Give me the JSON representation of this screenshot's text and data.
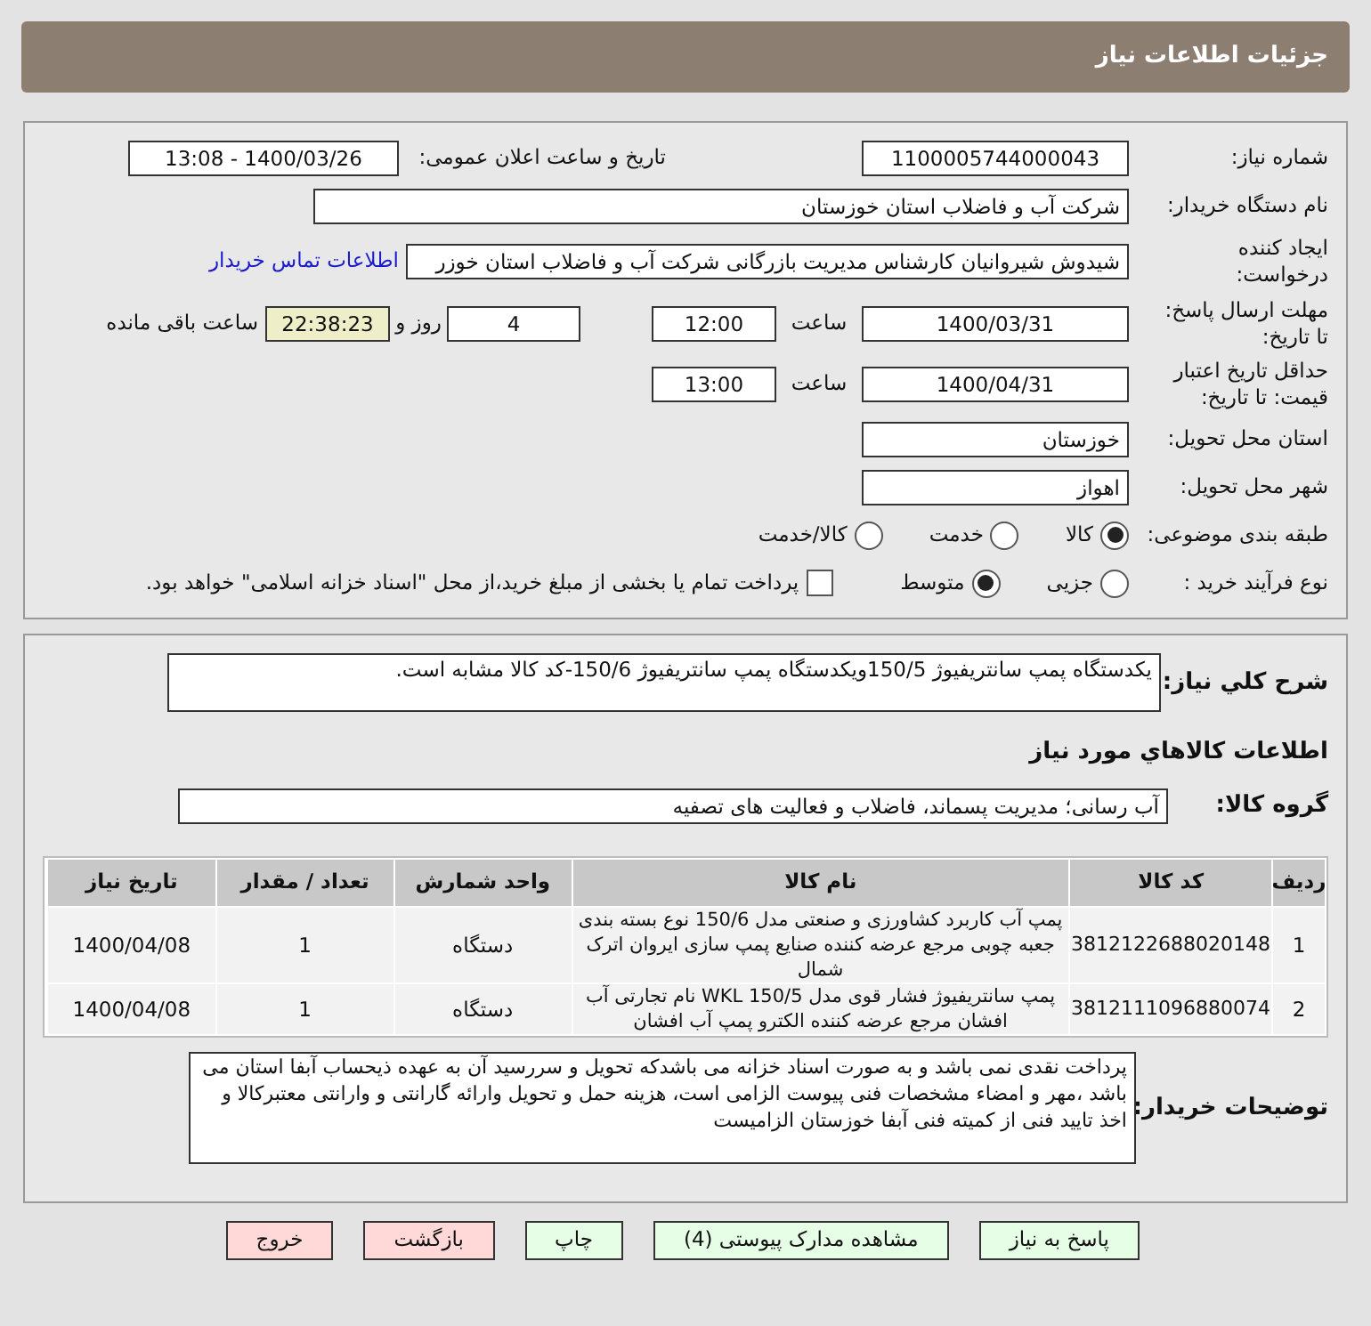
{
  "header": {
    "title": "جزئیات اطلاعات نیاز"
  },
  "need_number": {
    "label": "شماره نیاز:",
    "value": "1100005744000043"
  },
  "announce": {
    "label": "تاریخ و ساعت اعلان عمومی:",
    "value": "1400/03/26 - 13:08"
  },
  "buyer": {
    "label": "نام دستگاه خریدار:",
    "value": "شرکت آب و فاضلاب استان خوزستان"
  },
  "creator": {
    "label": "ایجاد کننده درخواست:",
    "value": "شیدوش شیروانیان کارشناس مدیریت بازرگانی شرکت آب و فاضلاب استان خوزر",
    "link": "اطلاعات تماس خریدار"
  },
  "reply_deadline": {
    "label": "مهلت ارسال پاسخ: تا تاریخ:",
    "date": "1400/03/31",
    "time_label": "ساعت",
    "time": "12:00",
    "days": "4",
    "days_label": "روز و",
    "remaining": "22:38:23",
    "remaining_label": "ساعت باقی مانده"
  },
  "price_validity": {
    "label": "حداقل تاریخ اعتبار قیمت: تا تاریخ:",
    "date": "1400/04/31",
    "time_label": "ساعت",
    "time": "13:00"
  },
  "province": {
    "label": "استان محل تحویل:",
    "value": "خوزستان"
  },
  "city": {
    "label": "شهر محل تحویل:",
    "value": "اهواز"
  },
  "category": {
    "label": "طبقه بندی موضوعی:",
    "options": [
      {
        "label": "کالا",
        "selected": true
      },
      {
        "label": "خدمت",
        "selected": false
      },
      {
        "label": "کالا/خدمت",
        "selected": false
      }
    ]
  },
  "process": {
    "label": "نوع فرآیند خرید :",
    "options": [
      {
        "label": "جزیی",
        "selected": false
      },
      {
        "label": "متوسط",
        "selected": true
      }
    ],
    "payment": {
      "checked": false,
      "label": "پرداخت تمام یا بخشی از مبلغ خرید،از محل \"اسناد خزانه اسلامی\" خواهد بود."
    }
  },
  "description": {
    "label": "شرح کلي نياز:",
    "value": "یکدستگاه پمپ سانتریفیوژ 150/5ویکدستگاه پمپ سانتریفیوژ 150/6-کد کالا مشابه است."
  },
  "goods_title": "اطلاعات کالاهاي مورد نياز",
  "goods_group": {
    "label": "گروه کالا:",
    "value": "آب رسانی؛ مدیریت پسماند، فاضلاب و فعالیت های تصفیه"
  },
  "table": {
    "columns": [
      "ردیف",
      "کد کالا",
      "نام کالا",
      "واحد شمارش",
      "تعداد / مقدار",
      "تاریخ نیاز"
    ],
    "rows": [
      [
        "1",
        "3812122688020148",
        "پمپ آب کاربرد کشاورزی و صنعتی مدل 150/6 نوع بسته بندی جعبه چوبی مرجع عرضه کننده صنایع پمپ سازی ایروان اترک شمال",
        "دستگاه",
        "1",
        "1400/04/08"
      ],
      [
        "2",
        "3812111096880074",
        "پمپ سانتریفیوژ فشار قوی مدل WKL 150/5 نام تجارتی آب افشان مرجع عرضه کننده الکترو پمپ آب افشان",
        "دستگاه",
        "1",
        "1400/04/08"
      ]
    ]
  },
  "buyer_notes": {
    "label": "توضیحات خریدار:",
    "value": "پرداخت نقدی نمی باشد و به صورت اسناد خزانه می باشدکه تحویل و سررسید آن به عهده ذیحساب آبفا استان می باشد ،مهر و امضاء مشخصات فنی پیوست الزامی است، هزینه حمل و تحویل وارائه گارانتی و وارانتی معتبرکالا و اخذ تایید فنی از کمیته فنی آبفا خوزستان الزامیست"
  },
  "buttons": [
    {
      "label": "پاسخ به نیاز",
      "kind": "action"
    },
    {
      "label": "مشاهده مدارک پیوستی (4)",
      "kind": "action"
    },
    {
      "label": "چاپ",
      "kind": "action"
    },
    {
      "label": "بازگشت",
      "kind": "exit"
    },
    {
      "label": "خروج",
      "kind": "exit"
    }
  ]
}
